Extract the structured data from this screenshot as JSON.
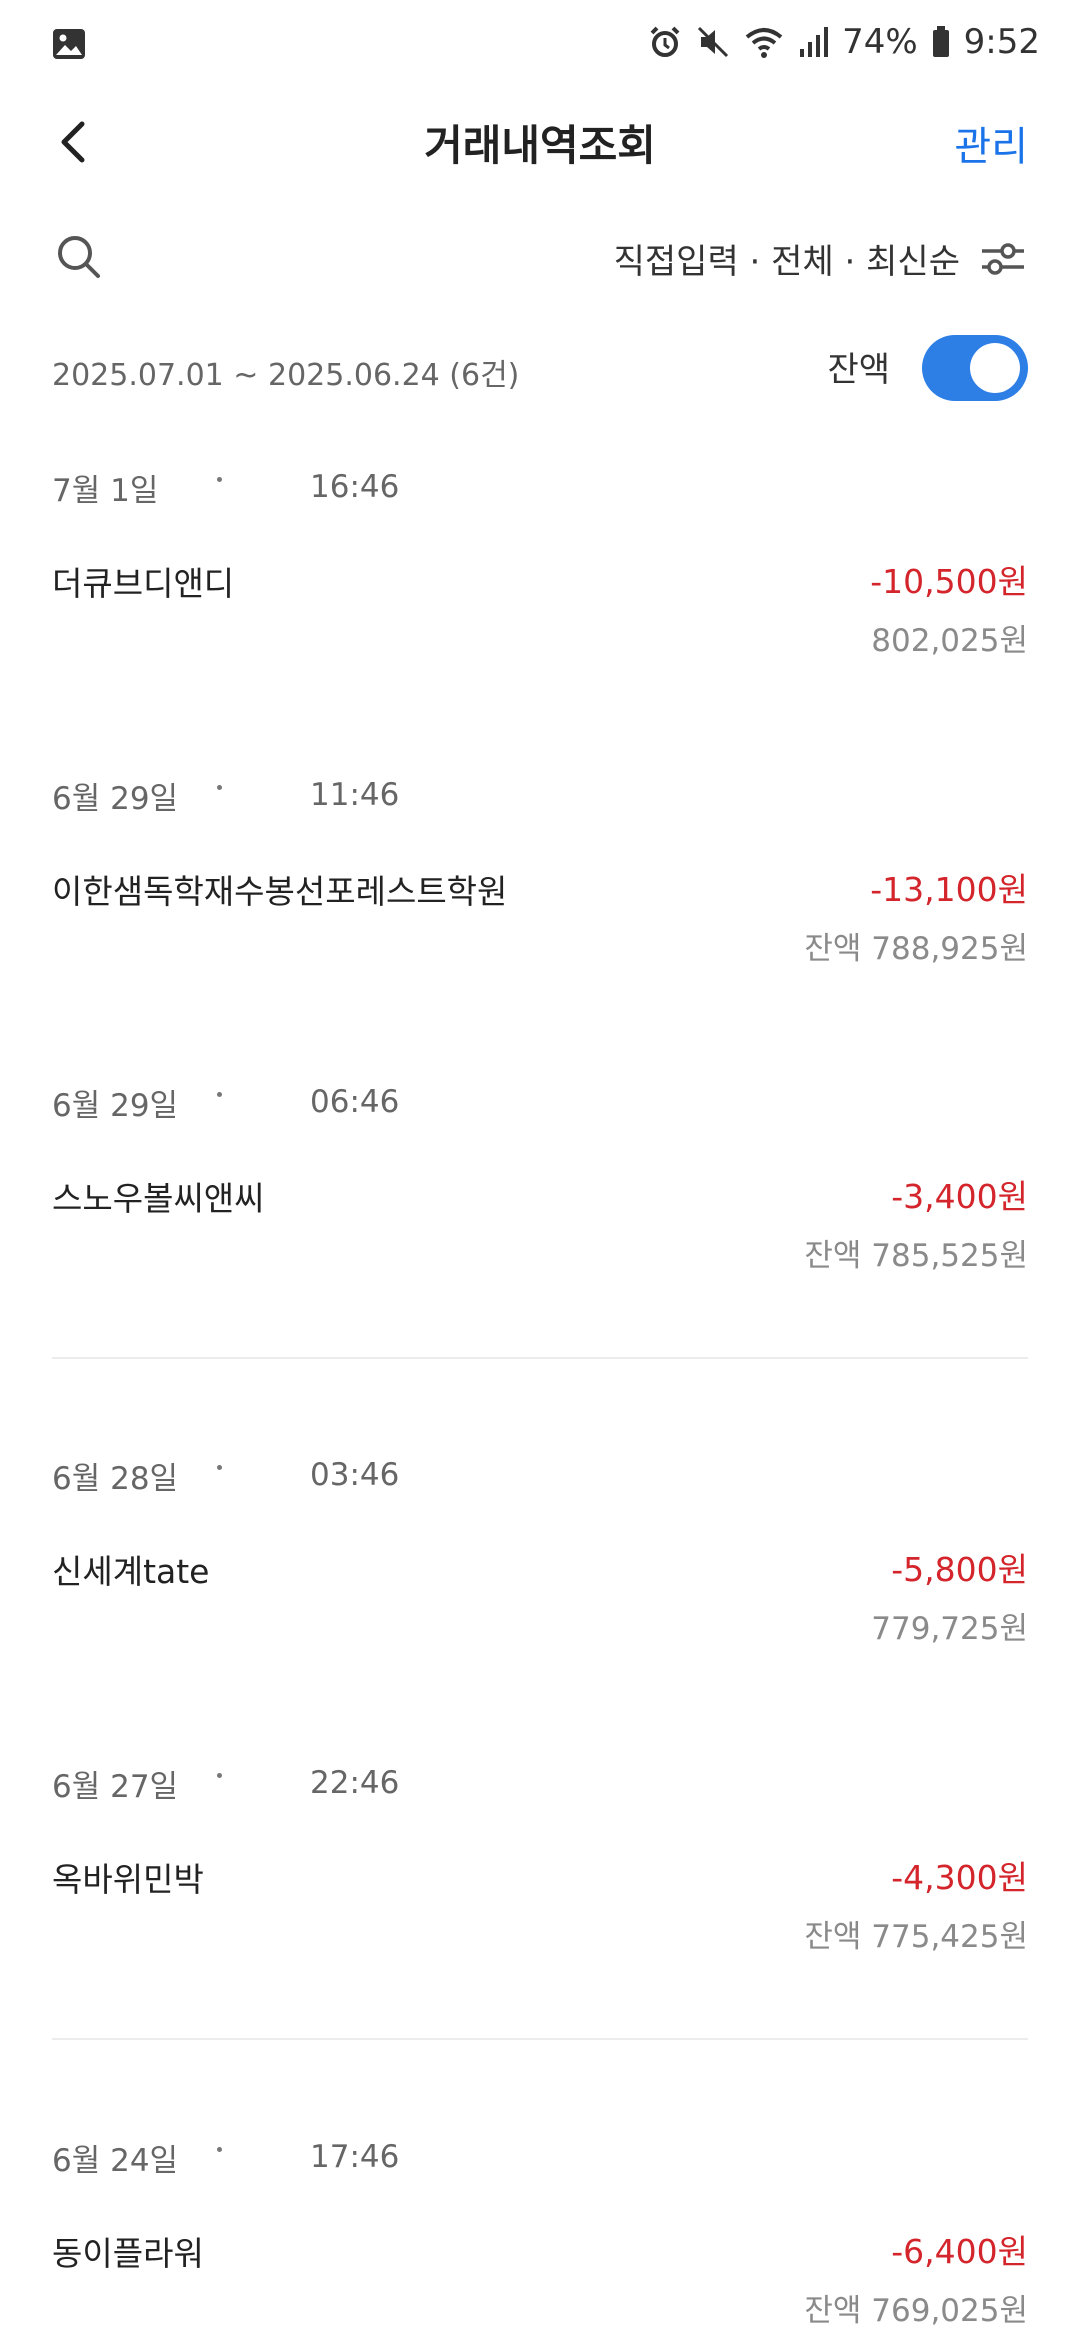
{
  "status": {
    "battery": "74%",
    "time": "9:52",
    "icons": [
      "gallery-icon",
      "alarm-icon",
      "mute-icon",
      "wifi-icon",
      "signal-icon",
      "battery-icon"
    ]
  },
  "header": {
    "title": "거래내역조회",
    "manage_label": "관리"
  },
  "filter": {
    "text": "직접입력 · 전체 · 최신순"
  },
  "summary": {
    "period": "2025.07.01 ~ 2025.06.24 (6건)",
    "balance_label": "잔액",
    "balance_toggle_on": true
  },
  "transactions": [
    {
      "date": "7월 1일",
      "time": "16:46",
      "name": "더큐브디앤디",
      "amount": "-10,500원",
      "balance": "802,025원"
    },
    {
      "date": "6월 29일",
      "time": "11:46",
      "name": "이한샘독학재수봉선포레스트학원",
      "amount": "-13,100원",
      "balance": "잔액 788,925원"
    },
    {
      "date": "6월 29일",
      "time": "06:46",
      "name": "스노우볼씨앤씨",
      "amount": "-3,400원",
      "balance": "잔액 785,525원"
    },
    {
      "date": "6월 28일",
      "time": "03:46",
      "name": "신세계tate",
      "amount": "-5,800원",
      "balance": "779,725원"
    },
    {
      "date": "6월 27일",
      "time": "22:46",
      "name": "옥바위민박",
      "amount": "-4,300원",
      "balance": "잔액 775,425원"
    },
    {
      "date": "6월 24일",
      "time": "17:46",
      "name": "동이플라워",
      "amount": "-6,400원",
      "balance": "잔액 769,025원"
    }
  ],
  "colors": {
    "accent": "#1a73e8",
    "toggle": "#2d7fe6",
    "debit": "#d3252b"
  }
}
